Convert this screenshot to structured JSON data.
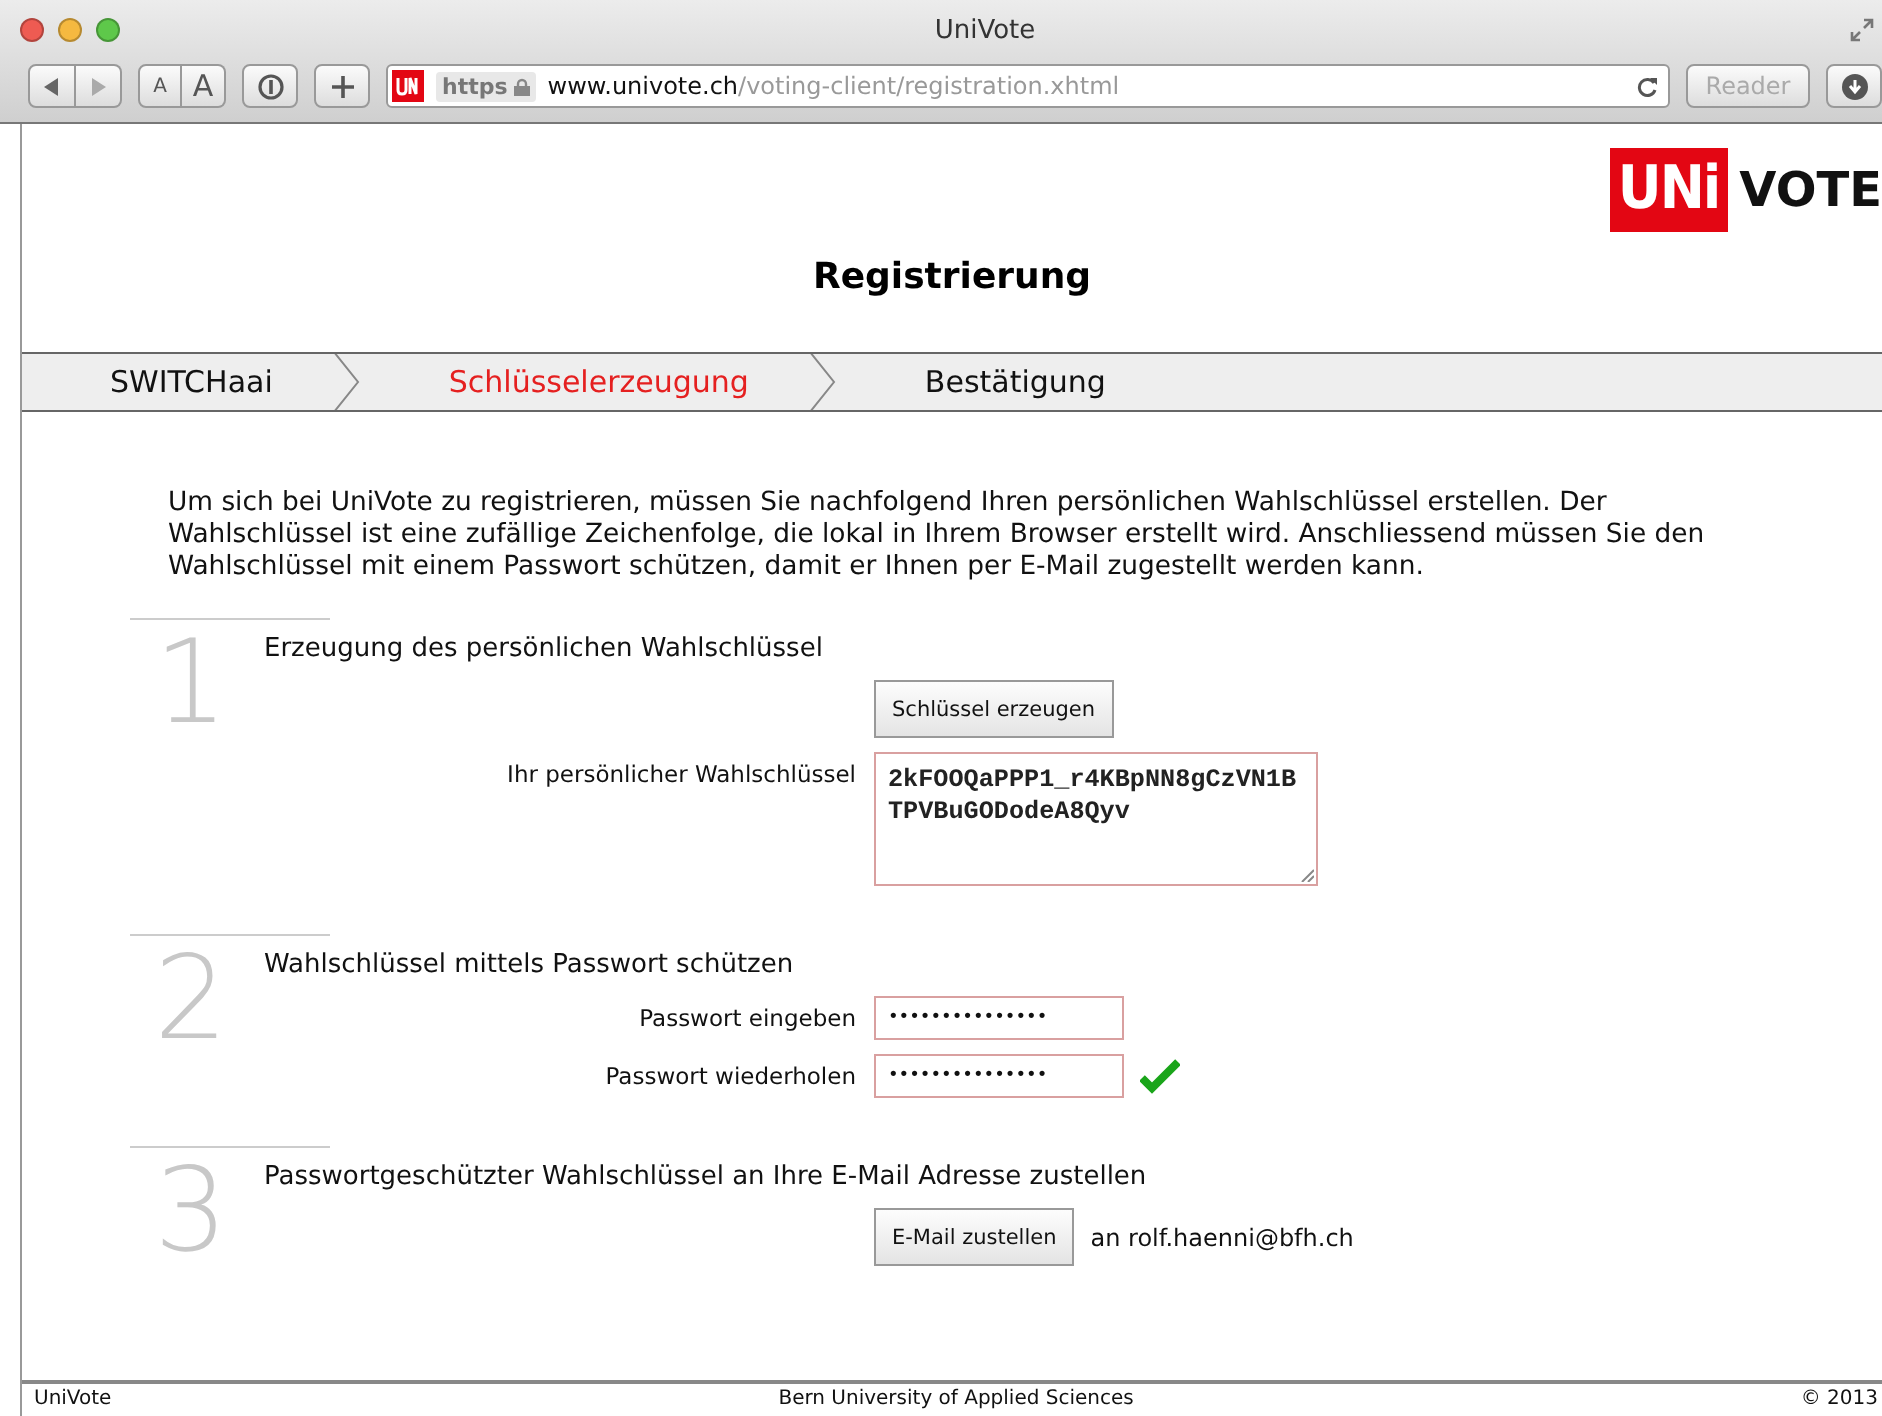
{
  "window": {
    "title": "UniVote"
  },
  "toolbar": {
    "text_size_small": "A",
    "text_size_large": "A",
    "scheme": "https",
    "domain": "www.univote.ch",
    "path": "/voting-client/registration.xhtml",
    "reader": "Reader"
  },
  "logo": {
    "uni": "UNi",
    "vote": "VOTE"
  },
  "heading": "Registrierung",
  "steps": [
    {
      "label": "SWITCHaai",
      "selected": false
    },
    {
      "label": "Schlüsselerzeugung",
      "selected": true
    },
    {
      "label": "Bestätigung",
      "selected": false
    }
  ],
  "intro": "Um sich bei UniVote zu registrieren, müssen Sie nachfolgend Ihren persönlichen Wahlschlüssel erstellen. Der Wahlschlüssel ist eine zufällige Zeichenfolge, die lokal in Ihrem Browser erstellt wird. Anschliessend müssen Sie den Wahlschlüssel mit einem Passwort schützen, damit er Ihnen per E-Mail zugestellt werden kann.",
  "sections": [
    {
      "number": "1",
      "title": "Erzeugung des persönlichen Wahlschlüssel",
      "rows": [
        {
          "kind": "button",
          "button": "Schlüssel erzeugen"
        },
        {
          "kind": "textarea",
          "label": "Ihr persönlicher Wahlschlüssel",
          "value": "2kFOOQaPPP1_r4KBpNN8gCzVN1BTPVBuGODodeA8Qyv"
        }
      ]
    },
    {
      "number": "2",
      "title": "Wahlschlüssel mittels Passwort schützen",
      "rows": [
        {
          "kind": "password",
          "label": "Passwort eingeben",
          "value": "•••••••••••••••",
          "valid": false
        },
        {
          "kind": "password",
          "label": "Passwort wiederholen",
          "value": "•••••••••••••••",
          "valid": true
        }
      ]
    },
    {
      "number": "3",
      "title": "Passwortgeschützter Wahlschlüssel an Ihre E-Mail Adresse zustellen",
      "rows": [
        {
          "kind": "button",
          "button": "E-Mail zustellen",
          "note": "an rolf.haenni@bfh.ch"
        }
      ]
    }
  ],
  "footer": {
    "left": "UniVote",
    "center": "Bern University of Applied Sciences",
    "right": "© 2013"
  }
}
